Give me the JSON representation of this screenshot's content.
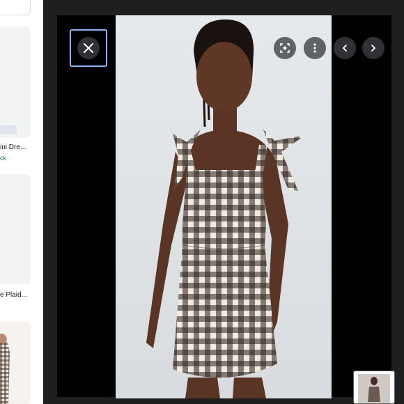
{
  "results": [
    {
      "title": "ini Dre...",
      "status": "ck"
    },
    {
      "title": "e Plaid..."
    }
  ],
  "viewer": {
    "close_icon": "close-icon",
    "lens_icon": "lens-icon",
    "more_icon": "more-vert-icon",
    "prev_icon": "chevron-left-icon",
    "next_icon": "chevron-right-icon"
  },
  "colors": {
    "viewer_bg": "#1f1f1f",
    "focus_ring": "#8ab4f8",
    "result_status": "#188038"
  }
}
